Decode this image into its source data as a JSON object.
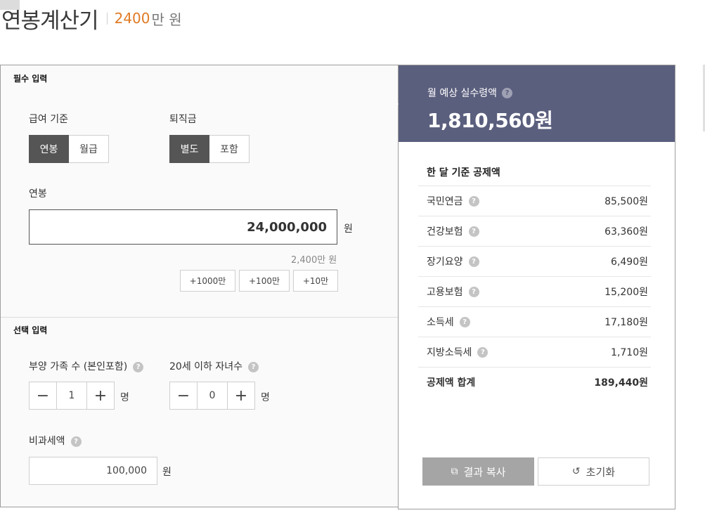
{
  "header": {
    "title": "연봉계산기",
    "amount": "2400",
    "unit": "만 원"
  },
  "required": {
    "section_label": "필수 입력",
    "pay_basis": {
      "label": "급여 기준",
      "options": [
        "연봉",
        "월급"
      ],
      "selected": "연봉"
    },
    "severance": {
      "label": "퇴직금",
      "options": [
        "별도",
        "포함"
      ],
      "selected": "별도"
    },
    "salary": {
      "label": "연봉",
      "value": "24,000,000",
      "unit": "원",
      "helper": "2,400만 원",
      "quick_buttons": [
        "+1000만",
        "+100만",
        "+10만"
      ]
    }
  },
  "optional": {
    "section_label": "선택 입력",
    "dependents": {
      "label": "부양 가족 수 (본인포함)",
      "value": "1",
      "unit": "명"
    },
    "children": {
      "label": "20세 이하 자녀수",
      "value": "0",
      "unit": "명"
    },
    "non_taxable": {
      "label": "비과세액",
      "value": "100,000",
      "unit": "원"
    }
  },
  "result": {
    "label": "월 예상 실수령액",
    "value": "1,810,560원",
    "deductions_title": "한 달 기준 공제액",
    "deductions": [
      {
        "name": "국민연금",
        "amount": "85,500원"
      },
      {
        "name": "건강보험",
        "amount": "63,360원"
      },
      {
        "name": "장기요양",
        "amount": "6,490원"
      },
      {
        "name": "고용보험",
        "amount": "15,200원"
      },
      {
        "name": "소득세",
        "amount": "17,180원"
      },
      {
        "name": "지방소득세",
        "amount": "1,710원"
      }
    ],
    "total": {
      "name": "공제액 합계",
      "amount": "189,440원"
    },
    "copy_button": "결과 복사",
    "reset_button": "초기화"
  },
  "icons": {
    "help": "?",
    "minus": "−",
    "plus": "+",
    "copy": "⧉",
    "reset": "↺"
  },
  "colors": {
    "accent": "#e07a24",
    "result_bg": "#5b5f7e",
    "active_seg": "#555555",
    "copy_btn": "#a5a5a5"
  }
}
